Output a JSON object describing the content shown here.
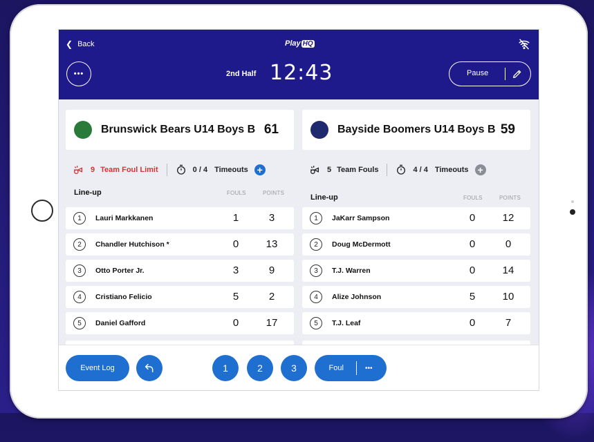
{
  "header": {
    "back_label": "Back",
    "logo_text": "Play",
    "logo_badge": "HQ",
    "period": "2nd Half",
    "clock": "12:43",
    "pause_label": "Pause",
    "menu_glyph": "•••"
  },
  "home_team": {
    "name": "Brunswick Bears U14 Boys B",
    "score": "61",
    "logo_color": "#2a7a3a",
    "fouls": "9",
    "fouls_label": "Team Foul Limit",
    "fouls_color": "#d83434",
    "timeouts": "0 / 4",
    "timeouts_label": "Timeouts",
    "plus_color": "#1f6fd1",
    "lineup_label": "Line-up",
    "fouls_col": "FOULS",
    "points_col": "POINTS",
    "players": [
      {
        "num": "1",
        "name": "Lauri Markkanen",
        "fouls": "1",
        "points": "3"
      },
      {
        "num": "2",
        "name": "Chandler Hutchison *",
        "fouls": "0",
        "points": "13"
      },
      {
        "num": "3",
        "name": "Otto Porter Jr.",
        "fouls": "3",
        "points": "9"
      },
      {
        "num": "4",
        "name": "Cristiano Felicio",
        "fouls": "5",
        "points": "2"
      },
      {
        "num": "5",
        "name": "Daniel Gafford",
        "fouls": "0",
        "points": "17"
      }
    ]
  },
  "away_team": {
    "name": "Bayside Boomers U14 Boys B",
    "score": "59",
    "logo_color": "#1f2a6e",
    "fouls": "5",
    "fouls_label": "Team Fouls",
    "timeouts": "4 / 4",
    "timeouts_label": "Timeouts",
    "plus_color": "#8a8d96",
    "lineup_label": "Line-up",
    "fouls_col": "FOULS",
    "points_col": "POINTS",
    "players": [
      {
        "num": "1",
        "name": "JaKarr Sampson",
        "fouls": "0",
        "points": "12"
      },
      {
        "num": "2",
        "name": "Doug McDermott",
        "fouls": "0",
        "points": "0"
      },
      {
        "num": "3",
        "name": "T.J. Warren",
        "fouls": "0",
        "points": "14"
      },
      {
        "num": "4",
        "name": "Alize Johnson",
        "fouls": "5",
        "points": "10"
      },
      {
        "num": "5",
        "name": "T.J. Leaf",
        "fouls": "0",
        "points": "7"
      }
    ]
  },
  "footer": {
    "event_log_label": "Event Log",
    "undo_icon": "undo-icon",
    "score_buttons": [
      "1",
      "2",
      "3"
    ],
    "foul_label": "Foul",
    "more_glyph": "•••"
  },
  "colors": {
    "header_bg": "#1f1a8c",
    "accent": "#1f6fd1"
  }
}
